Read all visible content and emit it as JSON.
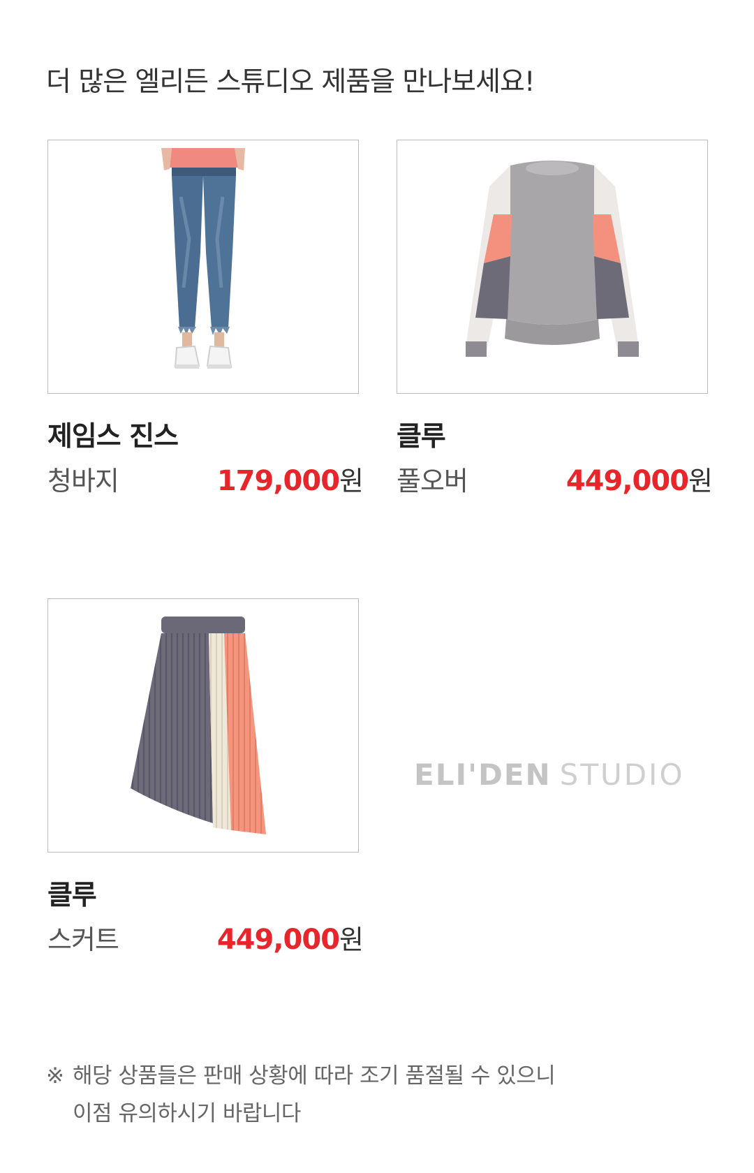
{
  "heading": "더 많은 엘리든 스튜디오 제품을 만나보세요!",
  "products": [
    {
      "image_icon": "jeans-image",
      "name": "제임스 진스",
      "category": "청바지",
      "price": "179,000",
      "currency": "원"
    },
    {
      "image_icon": "pullover-image",
      "name": "클루",
      "category": "풀오버",
      "price": "449,000",
      "currency": "원"
    },
    {
      "image_icon": "skirt-image",
      "name": "클루",
      "category": "스커트",
      "price": "449,000",
      "currency": "원"
    }
  ],
  "logo": {
    "brand": "ELI'DEN",
    "sub": "STUDIO"
  },
  "notice": {
    "mark": "※",
    "line1": "해당 상품들은 판매 상황에 따라 조기 품절될 수 있으니",
    "line2": "이점 유의하시기 바랍니다"
  },
  "colors": {
    "price": "#e6262a",
    "border": "#bcbcbc",
    "logo": "#c4c4c4"
  }
}
